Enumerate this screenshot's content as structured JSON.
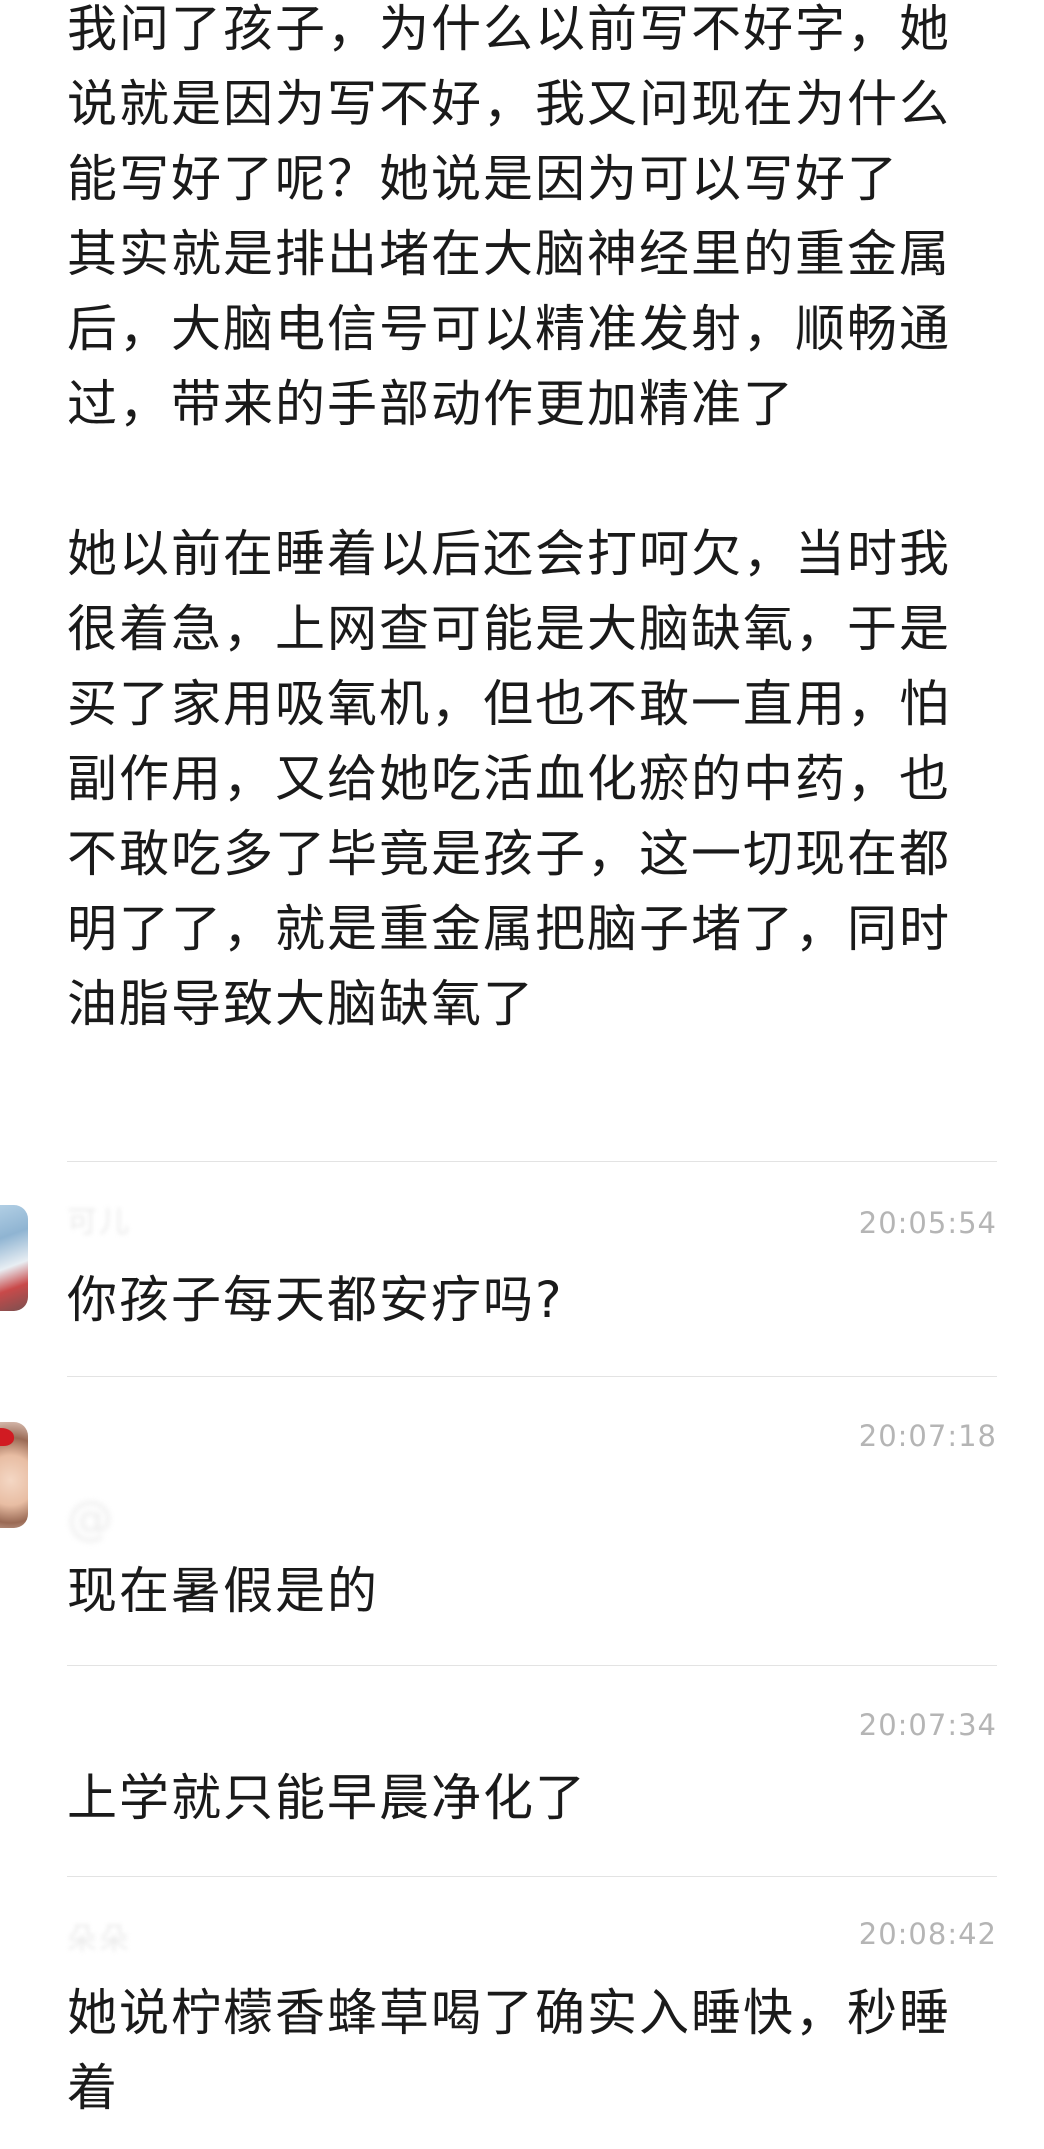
{
  "post": {
    "paragraph_1": "我问了孩子，为什么以前写不好字，她说就是因为写不好，我又问现在为什么能写好了呢？她说是因为可以写好了",
    "paragraph_2": "其实就是排出堵在大脑神经里的重金属后，大脑电信号可以精准发射，顺畅通过，带来的手部动作更加精准了",
    "paragraph_3": "她以前在睡着以后还会打呵欠，当时我很着急，上网查可能是大脑缺氧，于是买了家用吸氧机，但也不敢一直用，怕副作用，又给她吃活血化瘀的中药，也不敢吃多了毕竟是孩子，这一切现在都明了了，就是重金属把脑子堵了，同时油脂导致大脑缺氧了"
  },
  "comments": [
    {
      "username": "可儿",
      "time": "20:05:54",
      "text": "你孩子每天都安疗吗?"
    },
    {
      "username": "",
      "time": "20:07:18",
      "reply_to": "@",
      "text": "现在暑假是的"
    },
    {
      "username": "",
      "time": "20:07:34",
      "text": "上学就只能早晨净化了"
    },
    {
      "username": "朵朵",
      "time": "20:08:42",
      "text": "她说柠檬香蜂草喝了确实入睡快，秒睡着"
    }
  ]
}
